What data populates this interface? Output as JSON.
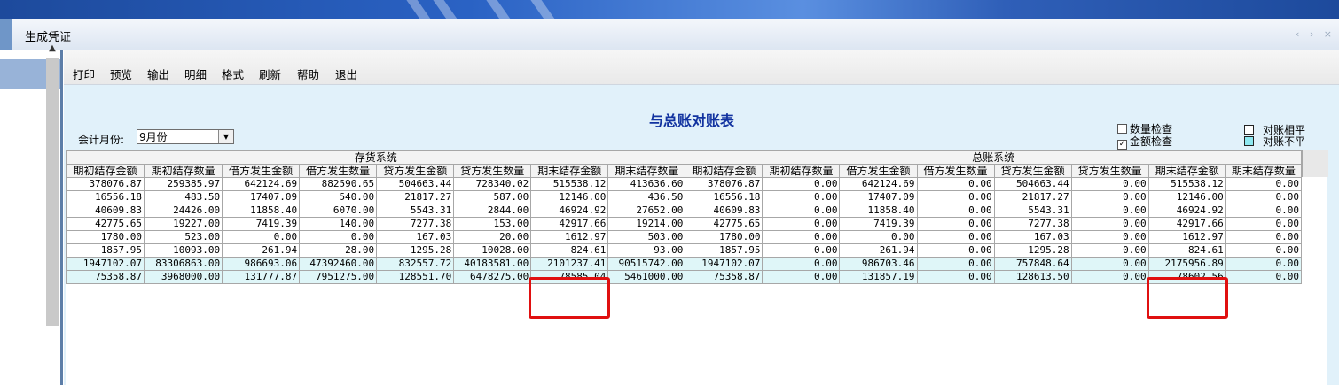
{
  "window": {
    "tab_title": "生成凭证",
    "tab_nav": "‹ › ×"
  },
  "toolbar": {
    "buttons": [
      "打印",
      "预览",
      "输出",
      "明细",
      "格式",
      "刷新",
      "帮助",
      "退出"
    ]
  },
  "report": {
    "title": "与总账对账表",
    "month_label": "会计月份:",
    "month_value": "9月份",
    "checks": [
      {
        "label": "数量检查",
        "checked": false
      },
      {
        "label": "金额检查",
        "checked": true
      }
    ],
    "legend": [
      {
        "label": "对账相平",
        "color": "#ffffff"
      },
      {
        "label": "对账不平",
        "color": "#8ee8f0"
      }
    ],
    "group_headers": [
      "存货系统",
      "总账系统"
    ],
    "columns": [
      "期初结存金额",
      "期初结存数量",
      "借方发生金额",
      "借方发生数量",
      "贷方发生金额",
      "贷方发生数量",
      "期末结存金额",
      "期末结存数量",
      "期初结存金额",
      "期初结存数量",
      "借方发生金额",
      "借方发生数量",
      "贷方发生金额",
      "贷方发生数量",
      "期末结存金额",
      "期末结存数量"
    ],
    "rows": [
      {
        "highlight": false,
        "cells": [
          "378076.87",
          "259385.97",
          "642124.69",
          "882590.65",
          "504663.44",
          "728340.02",
          "515538.12",
          "413636.60",
          "378076.87",
          "0.00",
          "642124.69",
          "0.00",
          "504663.44",
          "0.00",
          "515538.12",
          "0.00"
        ]
      },
      {
        "highlight": false,
        "cells": [
          "16556.18",
          "483.50",
          "17407.09",
          "540.00",
          "21817.27",
          "587.00",
          "12146.00",
          "436.50",
          "16556.18",
          "0.00",
          "17407.09",
          "0.00",
          "21817.27",
          "0.00",
          "12146.00",
          "0.00"
        ]
      },
      {
        "highlight": false,
        "cells": [
          "40609.83",
          "24426.00",
          "11858.40",
          "6070.00",
          "5543.31",
          "2844.00",
          "46924.92",
          "27652.00",
          "40609.83",
          "0.00",
          "11858.40",
          "0.00",
          "5543.31",
          "0.00",
          "46924.92",
          "0.00"
        ]
      },
      {
        "highlight": false,
        "cells": [
          "42775.65",
          "19227.00",
          "7419.39",
          "140.00",
          "7277.38",
          "153.00",
          "42917.66",
          "19214.00",
          "42775.65",
          "0.00",
          "7419.39",
          "0.00",
          "7277.38",
          "0.00",
          "42917.66",
          "0.00"
        ]
      },
      {
        "highlight": false,
        "cells": [
          "1780.00",
          "523.00",
          "0.00",
          "0.00",
          "167.03",
          "20.00",
          "1612.97",
          "503.00",
          "1780.00",
          "0.00",
          "0.00",
          "0.00",
          "167.03",
          "0.00",
          "1612.97",
          "0.00"
        ]
      },
      {
        "highlight": false,
        "cells": [
          "1857.95",
          "10093.00",
          "261.94",
          "28.00",
          "1295.28",
          "10028.00",
          "824.61",
          "93.00",
          "1857.95",
          "0.00",
          "261.94",
          "0.00",
          "1295.28",
          "0.00",
          "824.61",
          "0.00"
        ]
      },
      {
        "highlight": true,
        "cells": [
          "1947102.07",
          "83306863.00",
          "986693.06",
          "47392460.00",
          "832557.72",
          "40183581.00",
          "2101237.41",
          "90515742.00",
          "1947102.07",
          "0.00",
          "986703.46",
          "0.00",
          "757848.64",
          "0.00",
          "2175956.89",
          "0.00"
        ]
      },
      {
        "highlight": true,
        "cells": [
          "75358.87",
          "3968000.00",
          "131777.87",
          "7951275.00",
          "128551.70",
          "6478275.00",
          "78585.04",
          "5461000.00",
          "75358.87",
          "0.00",
          "131857.19",
          "0.00",
          "128613.50",
          "0.00",
          "78602.56",
          "0.00"
        ]
      }
    ]
  }
}
